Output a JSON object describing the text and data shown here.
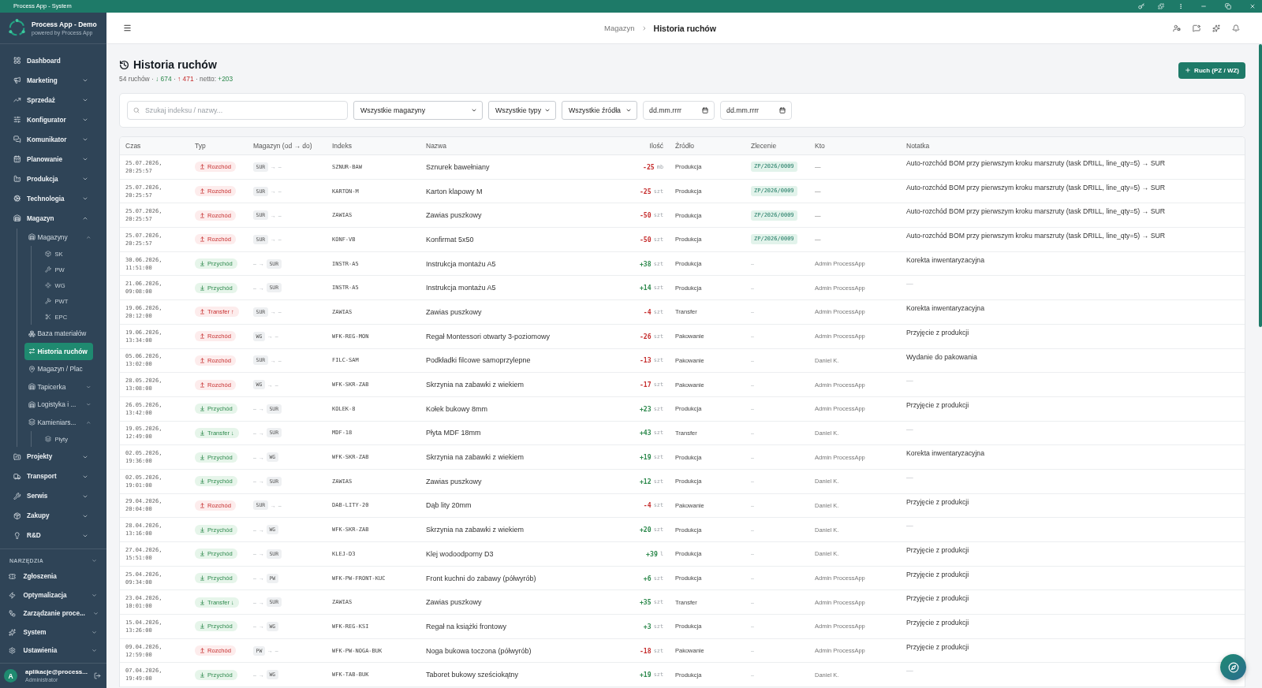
{
  "title_bar": {
    "title": "Process App - System"
  },
  "sidebar": {
    "app_name": "Process App - Demo",
    "app_tagline": "powered by Process App",
    "items": [
      {
        "label": "Dashboard",
        "selected": false
      },
      {
        "label": "Marketing",
        "selected": false,
        "expanded": false
      },
      {
        "label": "Sprzedaż",
        "selected": false,
        "expanded": false
      },
      {
        "label": "Konfigurator",
        "selected": false,
        "expanded": false
      },
      {
        "label": "Komunikator",
        "selected": false,
        "expanded": false
      },
      {
        "label": "Planowanie",
        "selected": false,
        "expanded": false
      },
      {
        "label": "Produkcja",
        "selected": false,
        "expanded": false
      },
      {
        "label": "Technologia",
        "selected": false,
        "expanded": false
      },
      {
        "label": "Magazyn",
        "selected": false,
        "expanded": true,
        "children": [
          {
            "label": "Magazyny",
            "selected": false,
            "expanded": true,
            "children": [
              {
                "label": "SK",
                "selected": false
              },
              {
                "label": "PW",
                "selected": false
              },
              {
                "label": "WG",
                "selected": false
              },
              {
                "label": "PWT",
                "selected": false
              },
              {
                "label": "EPC",
                "selected": false
              }
            ]
          },
          {
            "label": "Baza materiałów",
            "selected": false
          },
          {
            "label": "Historia ruchów",
            "selected": true
          },
          {
            "label": "Magazyn / Plac",
            "selected": false
          },
          {
            "label": "Tapicerka",
            "selected": false,
            "expanded": false
          },
          {
            "label": "Logistyka i ...",
            "selected": false,
            "expanded": false
          },
          {
            "label": "Kamieniars...",
            "selected": false,
            "expanded": true,
            "children": [
              {
                "label": "Płyty",
                "selected": false
              }
            ]
          }
        ]
      },
      {
        "label": "Projekty",
        "selected": false,
        "expanded": false
      },
      {
        "label": "Transport",
        "selected": false,
        "expanded": false
      },
      {
        "label": "Serwis",
        "selected": false,
        "expanded": false
      },
      {
        "label": "Zakupy",
        "selected": false,
        "expanded": false
      },
      {
        "label": "R&D",
        "selected": false,
        "expanded": false
      }
    ],
    "tools": {
      "title": "NARZĘDZIA",
      "expanded": true,
      "items": [
        {
          "label": "Zgłoszenia",
          "selected": false
        },
        {
          "label": "Optymalizacja",
          "selected": false,
          "expanded": false
        },
        {
          "label": "Zarządzanie proce...",
          "selected": false,
          "expanded": false
        },
        {
          "label": "System",
          "selected": false,
          "expanded": false
        },
        {
          "label": "Ustawienia",
          "selected": false,
          "expanded": false
        }
      ]
    },
    "user": {
      "initial": "A",
      "name": "aplikacje@process...",
      "role": "Administrator"
    }
  },
  "header": {
    "breadcrumb": [
      "Magazyn",
      "Historia ruchów"
    ]
  },
  "page": {
    "title": "Historia ruchów",
    "stats": [
      {
        "text": "54 ruchów",
        "kind": "plain"
      },
      {
        "text": "·",
        "kind": "plain"
      },
      {
        "text": "↓ 674",
        "kind": "in"
      },
      {
        "text": "·",
        "kind": "plain"
      },
      {
        "text": "↑ 471",
        "kind": "out"
      },
      {
        "text": "·",
        "kind": "plain"
      },
      {
        "text": "netto:",
        "kind": "plain"
      },
      {
        "text": "+203",
        "kind": "in"
      }
    ],
    "add_button": "Ruch (PZ / WZ)"
  },
  "filters": {
    "search": {
      "placeholder": "Szukaj indeksu / nazwy..."
    },
    "selects": [
      "Wszystkie magazyny",
      "Wszystkie typy",
      "Wszystkie źródła"
    ],
    "dates": [
      {
        "placeholder": "dd.mm.rrrr"
      },
      {
        "placeholder": "dd.mm.rrrr"
      }
    ]
  },
  "table": {
    "columns": [
      "Czas",
      "Typ",
      "Magazyn (od → do)",
      "Indeks",
      "Nazwa",
      "Ilość",
      "Źródło",
      "Zlecenie",
      "Kto",
      "Notatka"
    ],
    "rows": [
      {
        "time": "25.07.2026, 20:25:57",
        "type": {
          "kind": "out",
          "label": "Rozchód"
        },
        "warehouse": {
          "from": "SUR",
          "arrow": "→",
          "to": "–"
        },
        "index": "SZNUR-BAW",
        "name": "Sznurek bawełniany",
        "qty": {
          "amount": "-25",
          "unit": "mb"
        },
        "source": "Produkcja",
        "order": {
          "text": "ZP/2026/0009",
          "linked": true
        },
        "user": "—",
        "note": {
          "text": "Auto-rozchód BOM przy pierwszym kroku marszruty (task DRILL, line_qty=5) → SUR",
          "empty": false
        }
      },
      {
        "time": "25.07.2026, 20:25:57",
        "type": {
          "kind": "out",
          "label": "Rozchód"
        },
        "warehouse": {
          "from": "SUR",
          "arrow": "→",
          "to": "–"
        },
        "index": "KARTON-M",
        "name": "Karton klapowy M",
        "qty": {
          "amount": "-25",
          "unit": "szt"
        },
        "source": "Produkcja",
        "order": {
          "text": "ZP/2026/0009",
          "linked": true
        },
        "user": "—",
        "note": {
          "text": "Auto-rozchód BOM przy pierwszym kroku marszruty (task DRILL, line_qty=5) → SUR",
          "empty": false
        }
      },
      {
        "time": "25.07.2026, 20:25:57",
        "type": {
          "kind": "out",
          "label": "Rozchód"
        },
        "warehouse": {
          "from": "SUR",
          "arrow": "→",
          "to": "–"
        },
        "index": "ZAWIAS",
        "name": "Zawias puszkowy",
        "qty": {
          "amount": "-50",
          "unit": "szt"
        },
        "source": "Produkcja",
        "order": {
          "text": "ZP/2026/0009",
          "linked": true
        },
        "user": "—",
        "note": {
          "text": "Auto-rozchód BOM przy pierwszym kroku marszruty (task DRILL, line_qty=5) → SUR",
          "empty": false
        }
      },
      {
        "time": "25.07.2026, 20:25:57",
        "type": {
          "kind": "out",
          "label": "Rozchód"
        },
        "warehouse": {
          "from": "SUR",
          "arrow": "→",
          "to": "–"
        },
        "index": "KONF-VB",
        "name": "Konfirmat 5x50",
        "qty": {
          "amount": "-50",
          "unit": "szt"
        },
        "source": "Produkcja",
        "order": {
          "text": "ZP/2026/0009",
          "linked": true
        },
        "user": "—",
        "note": {
          "text": "Auto-rozchód BOM przy pierwszym kroku marszruty (task DRILL, line_qty=5) → SUR",
          "empty": false
        }
      },
      {
        "time": "30.06.2026, 11:51:00",
        "type": {
          "kind": "in",
          "label": "Przychód"
        },
        "warehouse": {
          "from": "–",
          "arrow": "→",
          "to": "SUR"
        },
        "index": "INSTR-A5",
        "name": "Instrukcja montażu A5",
        "qty": {
          "amount": "+38",
          "unit": "szt"
        },
        "source": "Produkcja",
        "order": {
          "text": "–",
          "linked": false
        },
        "user": "Admin ProcessApp",
        "note": {
          "text": "Korekta inwentaryzacyjna",
          "empty": false
        }
      },
      {
        "time": "21.06.2026, 09:08:00",
        "type": {
          "kind": "in",
          "label": "Przychód"
        },
        "warehouse": {
          "from": "–",
          "arrow": "→",
          "to": "SUR"
        },
        "index": "INSTR-A5",
        "name": "Instrukcja montażu A5",
        "qty": {
          "amount": "+14",
          "unit": "szt"
        },
        "source": "Produkcja",
        "order": {
          "text": "–",
          "linked": false
        },
        "user": "Admin ProcessApp",
        "note": {
          "text": "—",
          "empty": true
        }
      },
      {
        "time": "19.06.2026, 20:12:00",
        "type": {
          "kind": "out",
          "label": "Transfer ↑"
        },
        "warehouse": {
          "from": "SUR",
          "arrow": "→",
          "to": "–"
        },
        "index": "ZAWIAS",
        "name": "Zawias puszkowy",
        "qty": {
          "amount": "-4",
          "unit": "szt"
        },
        "source": "Transfer",
        "order": {
          "text": "–",
          "linked": false
        },
        "user": "Admin ProcessApp",
        "note": {
          "text": "Korekta inwentaryzacyjna",
          "empty": false
        }
      },
      {
        "time": "19.06.2026, 13:34:00",
        "type": {
          "kind": "out",
          "label": "Rozchód"
        },
        "warehouse": {
          "from": "WG",
          "arrow": "→",
          "to": "–"
        },
        "index": "WFK-REG-MON",
        "name": "Regał Montessori otwarty 3-poziomowy",
        "qty": {
          "amount": "-26",
          "unit": "szt"
        },
        "source": "Pakowanie",
        "order": {
          "text": "–",
          "linked": false
        },
        "user": "Admin ProcessApp",
        "note": {
          "text": "Przyjęcie z produkcji",
          "empty": false
        }
      },
      {
        "time": "05.06.2026, 13:02:00",
        "type": {
          "kind": "out",
          "label": "Rozchód"
        },
        "warehouse": {
          "from": "SUR",
          "arrow": "→",
          "to": "–"
        },
        "index": "FILC-SAM",
        "name": "Podkładki filcowe samoprzylepne",
        "qty": {
          "amount": "-13",
          "unit": "szt"
        },
        "source": "Pakowanie",
        "order": {
          "text": "–",
          "linked": false
        },
        "user": "Daniel K.",
        "note": {
          "text": "Wydanie do pakowania",
          "empty": false
        }
      },
      {
        "time": "28.05.2026, 13:08:00",
        "type": {
          "kind": "out",
          "label": "Rozchód"
        },
        "warehouse": {
          "from": "WG",
          "arrow": "→",
          "to": "–"
        },
        "index": "WFK-SKR-ZAB",
        "name": "Skrzynia na zabawki z wiekiem",
        "qty": {
          "amount": "-17",
          "unit": "szt"
        },
        "source": "Pakowanie",
        "order": {
          "text": "–",
          "linked": false
        },
        "user": "Admin ProcessApp",
        "note": {
          "text": "—",
          "empty": true
        }
      },
      {
        "time": "26.05.2026, 13:42:00",
        "type": {
          "kind": "in",
          "label": "Przychód"
        },
        "warehouse": {
          "from": "–",
          "arrow": "→",
          "to": "SUR"
        },
        "index": "KOLEK-8",
        "name": "Kołek bukowy 8mm",
        "qty": {
          "amount": "+23",
          "unit": "szt"
        },
        "source": "Produkcja",
        "order": {
          "text": "–",
          "linked": false
        },
        "user": "Admin ProcessApp",
        "note": {
          "text": "Przyjęcie z produkcji",
          "empty": false
        }
      },
      {
        "time": "19.05.2026, 12:49:00",
        "type": {
          "kind": "in",
          "label": "Transfer ↓"
        },
        "warehouse": {
          "from": "–",
          "arrow": "→",
          "to": "SUR"
        },
        "index": "MDF-18",
        "name": "Płyta MDF 18mm",
        "qty": {
          "amount": "+43",
          "unit": "szt"
        },
        "source": "Transfer",
        "order": {
          "text": "–",
          "linked": false
        },
        "user": "Daniel K.",
        "note": {
          "text": "—",
          "empty": true
        }
      },
      {
        "time": "02.05.2026, 19:36:00",
        "type": {
          "kind": "in",
          "label": "Przychód"
        },
        "warehouse": {
          "from": "–",
          "arrow": "→",
          "to": "WG"
        },
        "index": "WFK-SKR-ZAB",
        "name": "Skrzynia na zabawki z wiekiem",
        "qty": {
          "amount": "+19",
          "unit": "szt"
        },
        "source": "Produkcja",
        "order": {
          "text": "–",
          "linked": false
        },
        "user": "Admin ProcessApp",
        "note": {
          "text": "Korekta inwentaryzacyjna",
          "empty": false
        }
      },
      {
        "time": "02.05.2026, 19:01:00",
        "type": {
          "kind": "in",
          "label": "Przychód"
        },
        "warehouse": {
          "from": "–",
          "arrow": "→",
          "to": "SUR"
        },
        "index": "ZAWIAS",
        "name": "Zawias puszkowy",
        "qty": {
          "amount": "+12",
          "unit": "szt"
        },
        "source": "Produkcja",
        "order": {
          "text": "–",
          "linked": false
        },
        "user": "Daniel K.",
        "note": {
          "text": "—",
          "empty": true
        }
      },
      {
        "time": "29.04.2026, 20:04:00",
        "type": {
          "kind": "out",
          "label": "Rozchód"
        },
        "warehouse": {
          "from": "SUR",
          "arrow": "→",
          "to": "–"
        },
        "index": "DAB-LITY-20",
        "name": "Dąb lity 20mm",
        "qty": {
          "amount": "-4",
          "unit": "szt"
        },
        "source": "Pakowanie",
        "order": {
          "text": "–",
          "linked": false
        },
        "user": "Daniel K.",
        "note": {
          "text": "Przyjęcie z produkcji",
          "empty": false
        }
      },
      {
        "time": "28.04.2026, 13:16:00",
        "type": {
          "kind": "in",
          "label": "Przychód"
        },
        "warehouse": {
          "from": "–",
          "arrow": "→",
          "to": "WG"
        },
        "index": "WFK-SKR-ZAB",
        "name": "Skrzynia na zabawki z wiekiem",
        "qty": {
          "amount": "+20",
          "unit": "szt"
        },
        "source": "Produkcja",
        "order": {
          "text": "–",
          "linked": false
        },
        "user": "Daniel K.",
        "note": {
          "text": "—",
          "empty": true
        }
      },
      {
        "time": "27.04.2026, 15:51:00",
        "type": {
          "kind": "in",
          "label": "Przychód"
        },
        "warehouse": {
          "from": "–",
          "arrow": "→",
          "to": "SUR"
        },
        "index": "KLEJ-D3",
        "name": "Klej wodoodporny D3",
        "qty": {
          "amount": "+39",
          "unit": "l"
        },
        "source": "Produkcja",
        "order": {
          "text": "–",
          "linked": false
        },
        "user": "Daniel K.",
        "note": {
          "text": "Przyjęcie z produkcji",
          "empty": false
        }
      },
      {
        "time": "25.04.2026, 09:34:00",
        "type": {
          "kind": "in",
          "label": "Przychód"
        },
        "warehouse": {
          "from": "–",
          "arrow": "→",
          "to": "PW"
        },
        "index": "WFK-PW-FRONT-KUC",
        "name": "Front kuchni do zabawy (półwyrób)",
        "qty": {
          "amount": "+6",
          "unit": "szt"
        },
        "source": "Produkcja",
        "order": {
          "text": "–",
          "linked": false
        },
        "user": "Admin ProcessApp",
        "note": {
          "text": "Przyjęcie z produkcji",
          "empty": false
        }
      },
      {
        "time": "23.04.2026, 10:01:00",
        "type": {
          "kind": "in",
          "label": "Transfer ↓"
        },
        "warehouse": {
          "from": "–",
          "arrow": "→",
          "to": "SUR"
        },
        "index": "ZAWIAS",
        "name": "Zawias puszkowy",
        "qty": {
          "amount": "+35",
          "unit": "szt"
        },
        "source": "Transfer",
        "order": {
          "text": "–",
          "linked": false
        },
        "user": "Admin ProcessApp",
        "note": {
          "text": "Przyjęcie z produkcji",
          "empty": false
        }
      },
      {
        "time": "15.04.2026, 13:26:00",
        "type": {
          "kind": "in",
          "label": "Przychód"
        },
        "warehouse": {
          "from": "–",
          "arrow": "→",
          "to": "WG"
        },
        "index": "WFK-REG-KSI",
        "name": "Regał na książki frontowy",
        "qty": {
          "amount": "+3",
          "unit": "szt"
        },
        "source": "Produkcja",
        "order": {
          "text": "–",
          "linked": false
        },
        "user": "Admin ProcessApp",
        "note": {
          "text": "Przyjęcie z produkcji",
          "empty": false
        }
      },
      {
        "time": "09.04.2026, 12:59:00",
        "type": {
          "kind": "out",
          "label": "Rozchód"
        },
        "warehouse": {
          "from": "PW",
          "arrow": "→",
          "to": "–"
        },
        "index": "WFK-PW-NOGA-BUK",
        "name": "Noga bukowa toczona (półwyrób)",
        "qty": {
          "amount": "-18",
          "unit": "szt"
        },
        "source": "Pakowanie",
        "order": {
          "text": "–",
          "linked": false
        },
        "user": "Admin ProcessApp",
        "note": {
          "text": "Przyjęcie z produkcji",
          "empty": false
        }
      },
      {
        "time": "07.04.2026, 19:49:00",
        "type": {
          "kind": "in",
          "label": "Przychód"
        },
        "warehouse": {
          "from": "–",
          "arrow": "→",
          "to": "WG"
        },
        "index": "WFK-TAB-BUK",
        "name": "Taboret bukowy sześciokątny",
        "qty": {
          "amount": "+19",
          "unit": "szt"
        },
        "source": "Produkcja",
        "order": {
          "text": "–",
          "linked": false
        },
        "user": "Daniel K.",
        "note": {
          "text": "—",
          "empty": true
        }
      }
    ]
  }
}
